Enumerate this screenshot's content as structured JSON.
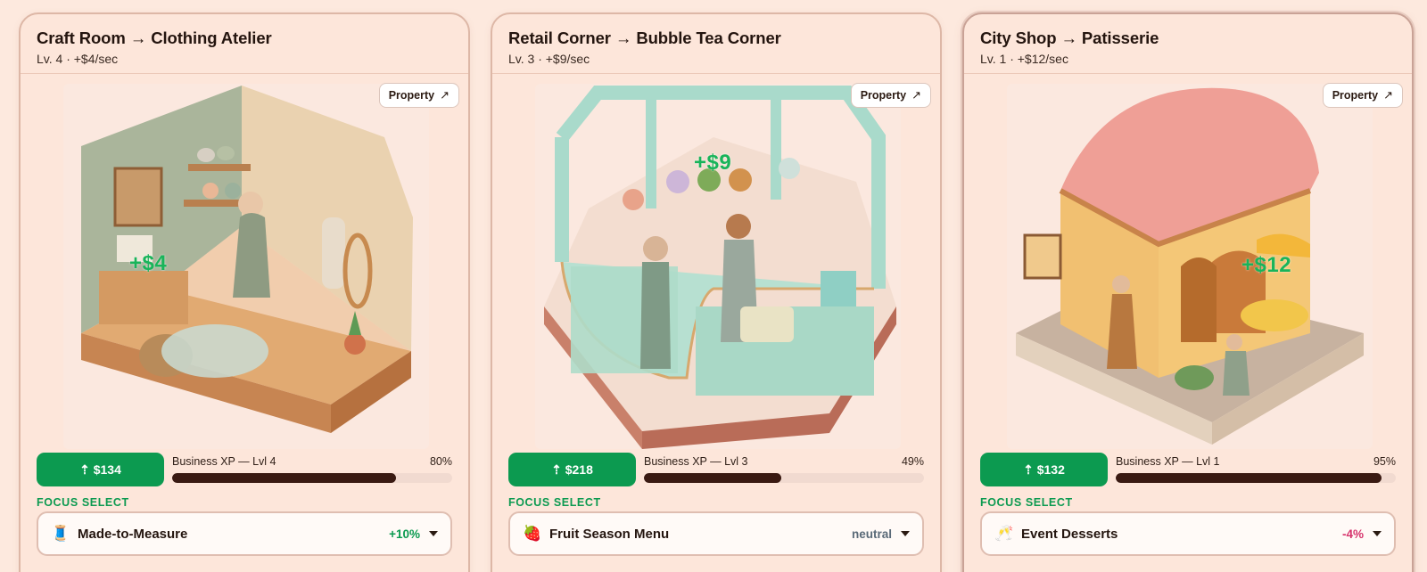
{
  "colors": {
    "background": "#fde9de",
    "upgrade_button": "#0c9a50",
    "xp_fill": "#3a1a12",
    "gain_text": "#19b45a",
    "modifier_positive": "#0c9a50",
    "modifier_neutral": "#5a6a78",
    "modifier_negative": "#d6336c"
  },
  "cards": [
    {
      "title": "Craft Room → Clothing Atelier",
      "subtitle": "Lv. 4 · +$4/sec",
      "property_label": "Property",
      "property_icon": "arrow-up-right-icon",
      "gain": "+$4",
      "upgrade_label": "⇡ $134",
      "xp_label": "Business XP — Lvl 4",
      "xp_percent": "80%",
      "xp_fraction": 0.8,
      "focus_label": "FOCUS SELECT",
      "focus_emoji": "🧵",
      "focus_name": "Made-to-Measure",
      "focus_modifier": "+10%",
      "modifier_tone": "positive"
    },
    {
      "title": "Retail Corner → Bubble Tea Corner",
      "subtitle": "Lv. 3 · +$9/sec",
      "property_label": "Property",
      "property_icon": "arrow-up-right-icon",
      "gain": "+$9",
      "upgrade_label": "⇡ $218",
      "xp_label": "Business XP — Lvl 3",
      "xp_percent": "49%",
      "xp_fraction": 0.49,
      "focus_label": "FOCUS SELECT",
      "focus_emoji": "🍓",
      "focus_name": "Fruit Season Menu",
      "focus_modifier": "neutral",
      "modifier_tone": "neutral"
    },
    {
      "title": "City Shop → Patisserie",
      "subtitle": "Lv. 1 · +$12/sec",
      "property_label": "Property",
      "property_icon": "arrow-up-right-icon",
      "gain": "+$12",
      "upgrade_label": "⇡ $132",
      "xp_label": "Business XP — Lvl 1",
      "xp_percent": "95%",
      "xp_fraction": 0.95,
      "focus_label": "FOCUS SELECT",
      "focus_emoji": "🥂",
      "focus_name": "Event Desserts",
      "focus_modifier": "-4%",
      "modifier_tone": "negative"
    }
  ]
}
